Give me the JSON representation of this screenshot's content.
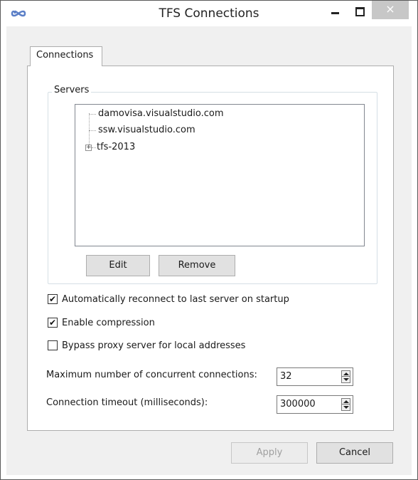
{
  "window": {
    "title": "TFS Connections",
    "icon": "infinity-icon",
    "close_glyph": "×"
  },
  "tabs": [
    {
      "label": "Connections",
      "selected": true
    }
  ],
  "servers_group": {
    "label": "Servers",
    "items": [
      {
        "label": "damovisa.visualstudio.com",
        "expandable": false
      },
      {
        "label": "ssw.visualstudio.com",
        "expandable": false
      },
      {
        "label": "tfs-2013",
        "expandable": true
      }
    ],
    "expander_glyph": "+",
    "edit_label": "Edit",
    "remove_label": "Remove"
  },
  "options": {
    "auto_reconnect": {
      "label": "Automatically reconnect to last server on startup",
      "checked": true
    },
    "compression": {
      "label": "Enable compression",
      "checked": true
    },
    "bypass_proxy": {
      "label": "Bypass proxy server for local addresses",
      "checked": false
    },
    "check_glyph": "✔"
  },
  "fields": {
    "max_connections": {
      "label": "Maximum number of concurrent connections:",
      "value": "32"
    },
    "timeout": {
      "label": "Connection timeout (milliseconds):",
      "value": "300000"
    }
  },
  "footer": {
    "apply_label": "Apply",
    "apply_enabled": false,
    "cancel_label": "Cancel"
  },
  "colors": {
    "window_border": "#5a5a5a",
    "panel_border": "#adadad",
    "close_button": "#c7c7c7"
  }
}
